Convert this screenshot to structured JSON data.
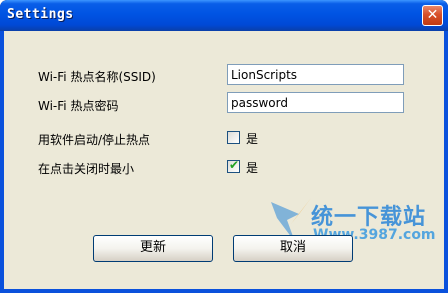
{
  "window": {
    "title": "Settings",
    "close_glyph": "✕"
  },
  "form": {
    "ssid_label": "Wi-Fi 热点名称(SSID)",
    "ssid_value": "LionScripts",
    "password_label": "Wi-Fi 热点密码",
    "password_value": "password",
    "toggle_hotspot_label": "用软件启动/停止热点",
    "toggle_hotspot_checkbox_label": "是",
    "toggle_hotspot_checked": false,
    "minimize_on_close_label": "在点击关闭时最小",
    "minimize_on_close_checkbox_label": "是",
    "minimize_on_close_checked": true,
    "check_glyph": "✔"
  },
  "buttons": {
    "update_label": "更新",
    "cancel_label": "取消"
  },
  "watermark": {
    "site_name": "统一下载站",
    "site_url": "Www.3987.com"
  },
  "colors": {
    "title_bar": "#0054e3",
    "close_button": "#d8502a",
    "dialog_background": "#ece9d8",
    "checkmark": "#21a121",
    "watermark": "#2a86d8"
  }
}
